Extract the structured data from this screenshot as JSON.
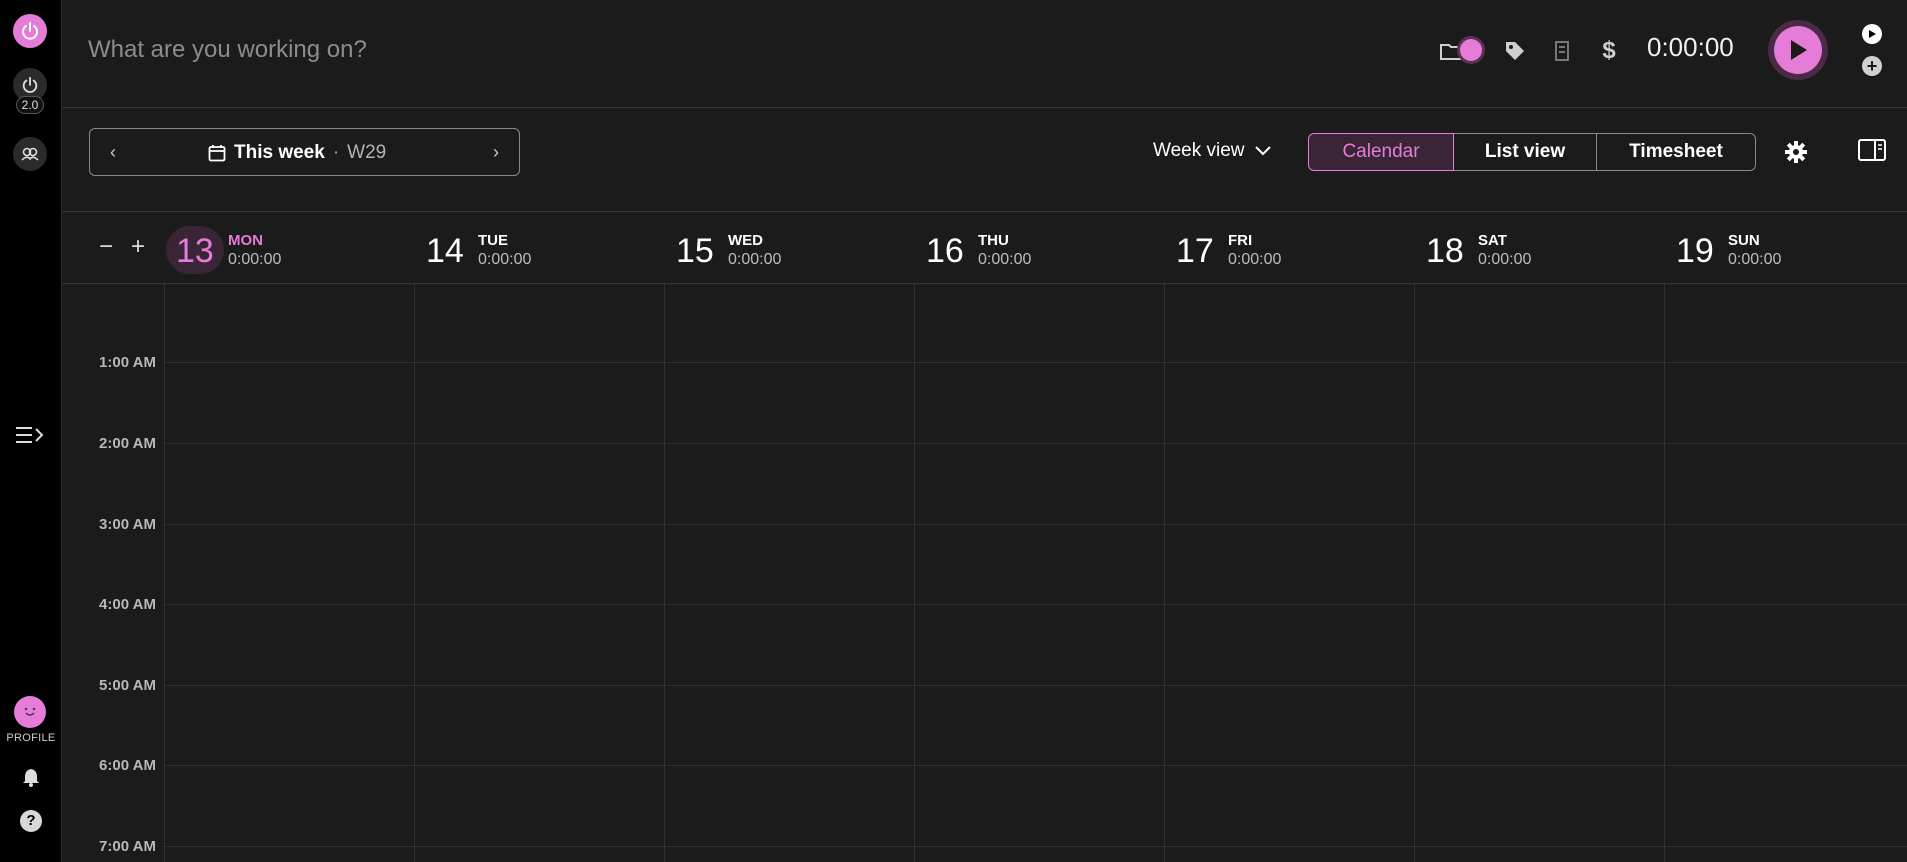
{
  "sidebar": {
    "version_badge": "2.0",
    "profile_label": "PROFILE"
  },
  "topbar": {
    "description_placeholder": "What are you working on?",
    "timer": "0:00:00"
  },
  "toolbar": {
    "week_label": "This week",
    "separator": "·",
    "week_number": "W29",
    "view_select": "Week view",
    "views": [
      "Calendar",
      "List view",
      "Timesheet"
    ],
    "active_view": "Calendar"
  },
  "days": [
    {
      "num": "13",
      "name": "MON",
      "total": "0:00:00",
      "today": true
    },
    {
      "num": "14",
      "name": "TUE",
      "total": "0:00:00"
    },
    {
      "num": "15",
      "name": "WED",
      "total": "0:00:00"
    },
    {
      "num": "16",
      "name": "THU",
      "total": "0:00:00"
    },
    {
      "num": "17",
      "name": "FRI",
      "total": "0:00:00"
    },
    {
      "num": "18",
      "name": "SAT",
      "total": "0:00:00"
    },
    {
      "num": "19",
      "name": "SUN",
      "total": "0:00:00"
    }
  ],
  "hours": [
    "1:00 AM",
    "2:00 AM",
    "3:00 AM",
    "4:00 AM",
    "5:00 AM",
    "6:00 AM",
    "7:00 AM"
  ],
  "colors": {
    "accent": "#e57cd8",
    "background": "#1b1b1b",
    "sidebar": "#000000"
  },
  "icons": {
    "logo": "power-icon",
    "team": "people-icon",
    "collapse": "collapse-menu-icon",
    "notifications": "bell-icon",
    "help": "help-icon",
    "project": "folder-toggle-icon",
    "tag": "tag-icon",
    "receipt": "receipt-icon",
    "billable": "dollar-icon",
    "settings": "gear-icon",
    "panel": "sidebar-panel-icon"
  }
}
